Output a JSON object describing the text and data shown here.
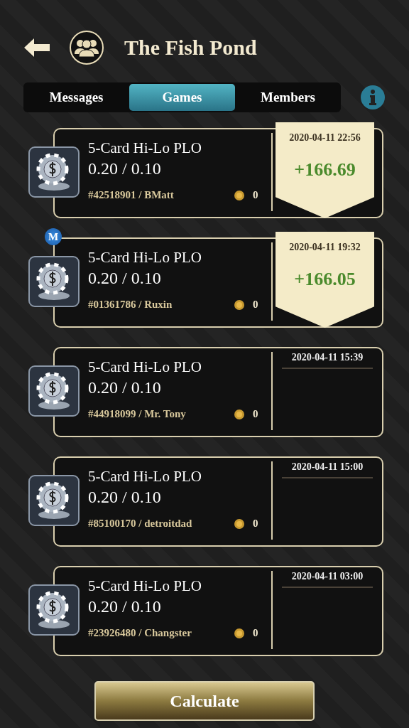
{
  "header": {
    "title": "The Fish Pond"
  },
  "tabs": [
    {
      "label": "Messages",
      "selected": false
    },
    {
      "label": "Games",
      "selected": true
    },
    {
      "label": "Members",
      "selected": false
    }
  ],
  "games": [
    {
      "title": "5-Card Hi-Lo PLO",
      "stakes": "0.20 / 0.10",
      "table": "#42518901 / BMatt",
      "coins": "0",
      "date": "2020-04-11 22:56",
      "result": "+166.69"
    },
    {
      "title": "5-Card Hi-Lo PLO",
      "stakes": "0.20 / 0.10",
      "table": "#01361786 / Ruxin",
      "coins": "0",
      "date": "2020-04-11 19:32",
      "result": "+166.05",
      "badge": "M"
    },
    {
      "title": "5-Card Hi-Lo PLO",
      "stakes": "0.20 / 0.10",
      "table": "#44918099 / Mr. Tony",
      "coins": "0",
      "date": "2020-04-11 15:39"
    },
    {
      "title": "5-Card Hi-Lo PLO",
      "stakes": "0.20 / 0.10",
      "table": "#85100170 / detroitdad",
      "coins": "0",
      "date": "2020-04-11 15:00"
    },
    {
      "title": "5-Card Hi-Lo PLO",
      "stakes": "0.20 / 0.10",
      "table": "#23926480 / Changster",
      "coins": "0",
      "date": "2020-04-11 03:00"
    }
  ],
  "action": {
    "label": "Calculate"
  }
}
